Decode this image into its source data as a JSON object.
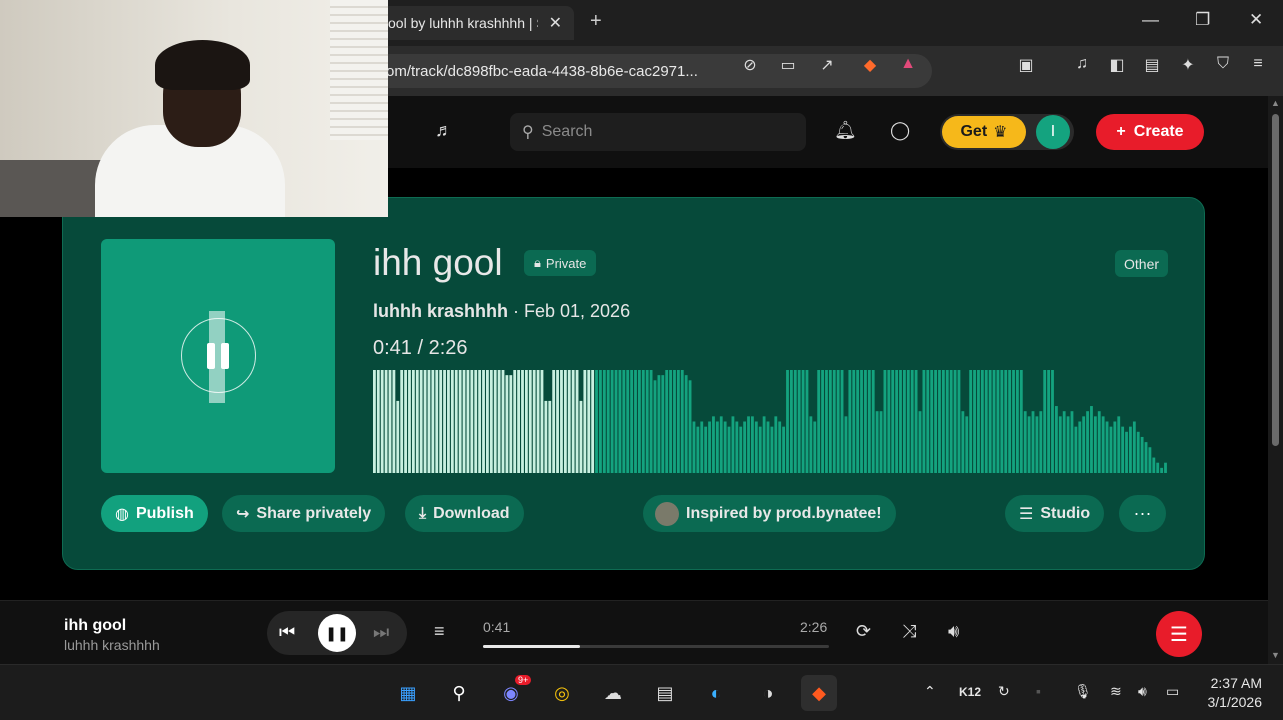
{
  "browser": {
    "tab_title": "ool by luhhh krashhhh | S",
    "tab_close": "✕",
    "new_tab": "+",
    "url": "om/track/dc898fbc-eada-4438-8b6e-cac2971...",
    "window_controls": [
      "—",
      "❐",
      "✕"
    ]
  },
  "header": {
    "search_placeholder": "Search",
    "get_label": "Get",
    "avatar_letter": "I",
    "create_label": "Create"
  },
  "track": {
    "title": "ihh gool",
    "visibility": "Private",
    "genre": "Other",
    "artist": "luhhh krashhhh",
    "date": " · Feb 01, 2026",
    "time_display": "0:41 /  2:26",
    "played_fraction": 0.28,
    "waveform": [
      1,
      1,
      1,
      1,
      1,
      1,
      0.7,
      1,
      1,
      1,
      1,
      1,
      1,
      1,
      1,
      1,
      1,
      1,
      1,
      1,
      1,
      1,
      1,
      1,
      1,
      1,
      1,
      1,
      1,
      1,
      1,
      1,
      1,
      1,
      0.95,
      0.95,
      1,
      1,
      1,
      1,
      1,
      1,
      1,
      1,
      0.7,
      0.7,
      1,
      1,
      1,
      1,
      1,
      1,
      1,
      0.7,
      1,
      1,
      1,
      1,
      1,
      1,
      1,
      1,
      1,
      1,
      1,
      1,
      1,
      1,
      1,
      1,
      1,
      1,
      0.9,
      0.95,
      0.95,
      1,
      1,
      1,
      1,
      1,
      0.95,
      0.9,
      0.5,
      0.45,
      0.5,
      0.45,
      0.5,
      0.55,
      0.5,
      0.55,
      0.5,
      0.45,
      0.55,
      0.5,
      0.45,
      0.5,
      0.55,
      0.55,
      0.5,
      0.45,
      0.55,
      0.5,
      0.45,
      0.55,
      0.5,
      0.45,
      1,
      1,
      1,
      1,
      1,
      1,
      0.55,
      0.5,
      1,
      1,
      1,
      1,
      1,
      1,
      1,
      0.55,
      1,
      1,
      1,
      1,
      1,
      1,
      1,
      0.6,
      0.6,
      1,
      1,
      1,
      1,
      1,
      1,
      1,
      1,
      1,
      0.6,
      1,
      1,
      1,
      1,
      1,
      1,
      1,
      1,
      1,
      1,
      0.6,
      0.55,
      1,
      1,
      1,
      1,
      1,
      1,
      1,
      1,
      1,
      1,
      1,
      1,
      1,
      1,
      0.6,
      0.55,
      0.6,
      0.55,
      0.6,
      1,
      1,
      1,
      0.65,
      0.55,
      0.6,
      0.55,
      0.6,
      0.45,
      0.5,
      0.55,
      0.6,
      0.65,
      0.55,
      0.6,
      0.55,
      0.5,
      0.45,
      0.5,
      0.55,
      0.45,
      0.4,
      0.45,
      0.5,
      0.4,
      0.35,
      0.3,
      0.25,
      0.15,
      0.1,
      0.05,
      0.1
    ],
    "actions": {
      "publish": "Publish",
      "share": "Share privately",
      "download": "Download",
      "inspired": "Inspired by prod.bynatee!",
      "studio": "Studio",
      "more": "···"
    }
  },
  "player": {
    "title": "ihh gool",
    "artist": "luhhh krashhhh",
    "current": "0:41",
    "duration": "2:26",
    "progress_fraction": 0.28
  },
  "taskbar": {
    "tray_k12": "K12",
    "time": "2:37 AM",
    "date": "3/1/2026",
    "discord_badge": "9+"
  },
  "colors": {
    "card_bg": "#064a3a",
    "accent_green": "#12a17e",
    "played_bar": "#c8f0e0",
    "unplayed_bar": "#14a37f",
    "create_red": "#e81c2a",
    "get_yellow": "#f6b81a"
  }
}
